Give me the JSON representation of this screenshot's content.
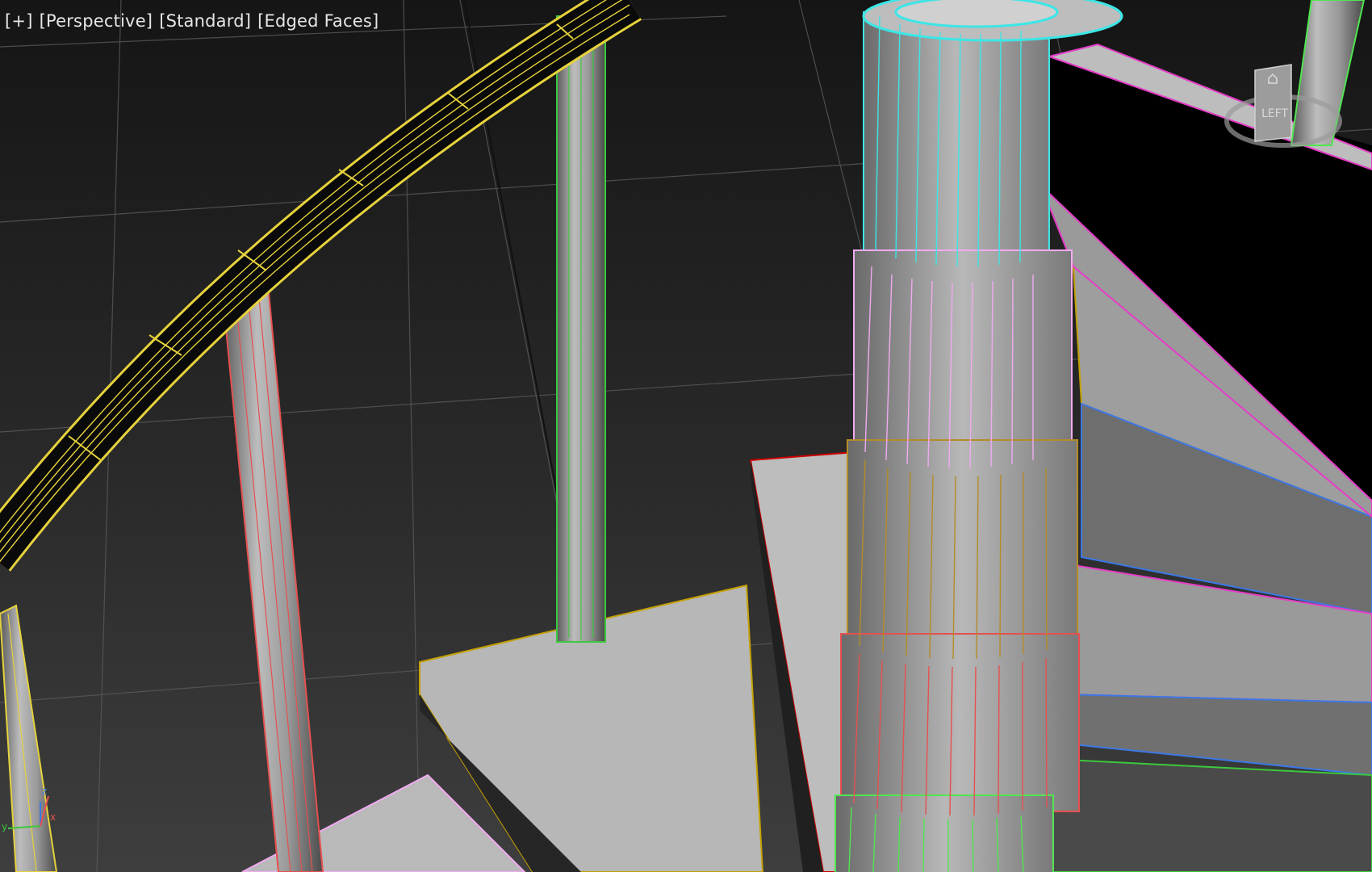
{
  "viewport": {
    "menu_labels": {
      "plus": "[+]",
      "view": "[Perspective]",
      "shading": "[Standard]",
      "edges": "[Edged Faces]"
    },
    "viewcube": {
      "face_label": "LEFT",
      "icon": "viewcube-icon",
      "home_icon": "home-icon"
    },
    "axis_triad": {
      "x_label": "x",
      "y_label": "y",
      "z_label": "z"
    },
    "object_colors": {
      "handrail": "#e6d23c",
      "baluster_green": "#3cc83c",
      "baluster_red": "#e65050",
      "column_cyan": "#3ce6e6",
      "column_pink": "#f0aaf0",
      "column_olive": "#b48c28",
      "column_red": "#e65050",
      "column_green": "#50e650",
      "stair_magenta": "#e63cc8",
      "stair_blue": "#3c78e6"
    }
  }
}
